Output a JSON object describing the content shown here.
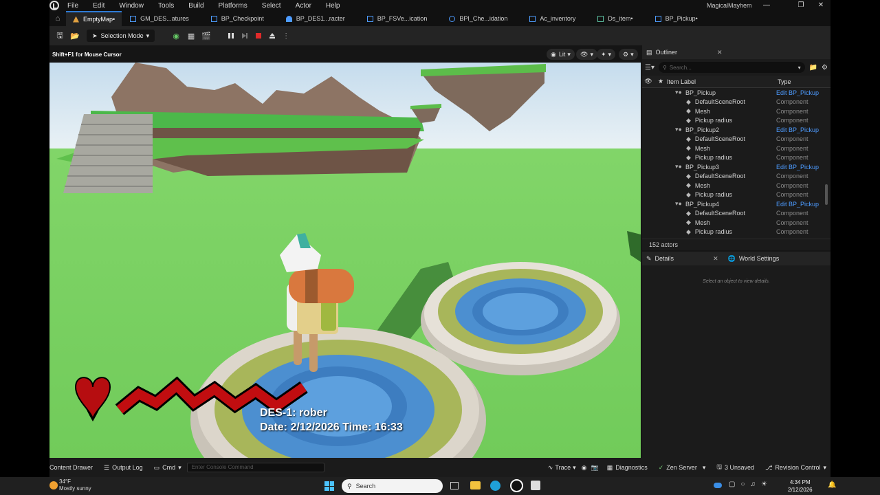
{
  "app": {
    "name": "MagicalMayhem",
    "menu": [
      "File",
      "Edit",
      "Window",
      "Tools",
      "Build",
      "Platforms",
      "Select",
      "Actor",
      "Help"
    ]
  },
  "tabs": [
    {
      "label": "EmptyMap•",
      "active": true
    },
    {
      "label": "GM_DES...atures",
      "active": false
    },
    {
      "label": "BP_Checkpoint",
      "active": false
    },
    {
      "label": "BP_DES1...racter",
      "active": false
    },
    {
      "label": "BP_FSVe...ication",
      "active": false
    },
    {
      "label": "BPI_Che...idation",
      "active": false
    },
    {
      "label": "Ac_inventory",
      "active": false
    },
    {
      "label": "Ds_item•",
      "active": false
    },
    {
      "label": "BP_Pickup•",
      "active": false
    }
  ],
  "toolbar": {
    "selection_mode": "Selection Mode"
  },
  "viewport": {
    "hint": "Shift+F1 for Mouse Cursor",
    "view_mode": "Lit",
    "hud_line1": "DES-1: rober",
    "hud_line2": "Date: 2/12/2026  Time: 16:33"
  },
  "outliner": {
    "title": "Outliner",
    "search_placeholder": "Search...",
    "col_label": "Item Label",
    "col_type": "Type",
    "rows": [
      {
        "label": "BP_Pickup",
        "type": "Edit BP_Pickup",
        "level": 0
      },
      {
        "label": "DefaultSceneRoot",
        "type": "Component",
        "level": 1
      },
      {
        "label": "Mesh",
        "type": "Component",
        "level": 1
      },
      {
        "label": "Pickup radius",
        "type": "Component",
        "level": 1
      },
      {
        "label": "BP_Pickup2",
        "type": "Edit BP_Pickup",
        "level": 0
      },
      {
        "label": "DefaultSceneRoot",
        "type": "Component",
        "level": 1
      },
      {
        "label": "Mesh",
        "type": "Component",
        "level": 1
      },
      {
        "label": "Pickup radius",
        "type": "Component",
        "level": 1
      },
      {
        "label": "BP_Pickup3",
        "type": "Edit BP_Pickup",
        "level": 0
      },
      {
        "label": "DefaultSceneRoot",
        "type": "Component",
        "level": 1
      },
      {
        "label": "Mesh",
        "type": "Component",
        "level": 1
      },
      {
        "label": "Pickup radius",
        "type": "Component",
        "level": 1
      },
      {
        "label": "BP_Pickup4",
        "type": "Edit BP_Pickup",
        "level": 0
      },
      {
        "label": "DefaultSceneRoot",
        "type": "Component",
        "level": 1
      },
      {
        "label": "Mesh",
        "type": "Component",
        "level": 1
      },
      {
        "label": "Pickup radius",
        "type": "Component",
        "level": 1
      }
    ],
    "actor_count": "152 actors"
  },
  "details": {
    "title": "Details",
    "world_settings": "World Settings",
    "empty_hint": "Select an object to view details."
  },
  "statusbar": {
    "content_drawer": "Content Drawer",
    "output_log": "Output Log",
    "cmd": "Cmd",
    "console_placeholder": "Enter Console Command",
    "trace": "Trace",
    "diagnostics": "Diagnostics",
    "zen_server": "Zen Server",
    "unsaved": "3 Unsaved",
    "revision_control": "Revision Control"
  },
  "taskbar": {
    "temp": "34°F",
    "weather": "Mostly sunny",
    "search": "Search",
    "time": "4:34 PM",
    "date": "2/12/2026"
  },
  "colors": {
    "accent": "#2e7bd6",
    "link": "#4d9bff",
    "grass": "#7fd36a"
  }
}
